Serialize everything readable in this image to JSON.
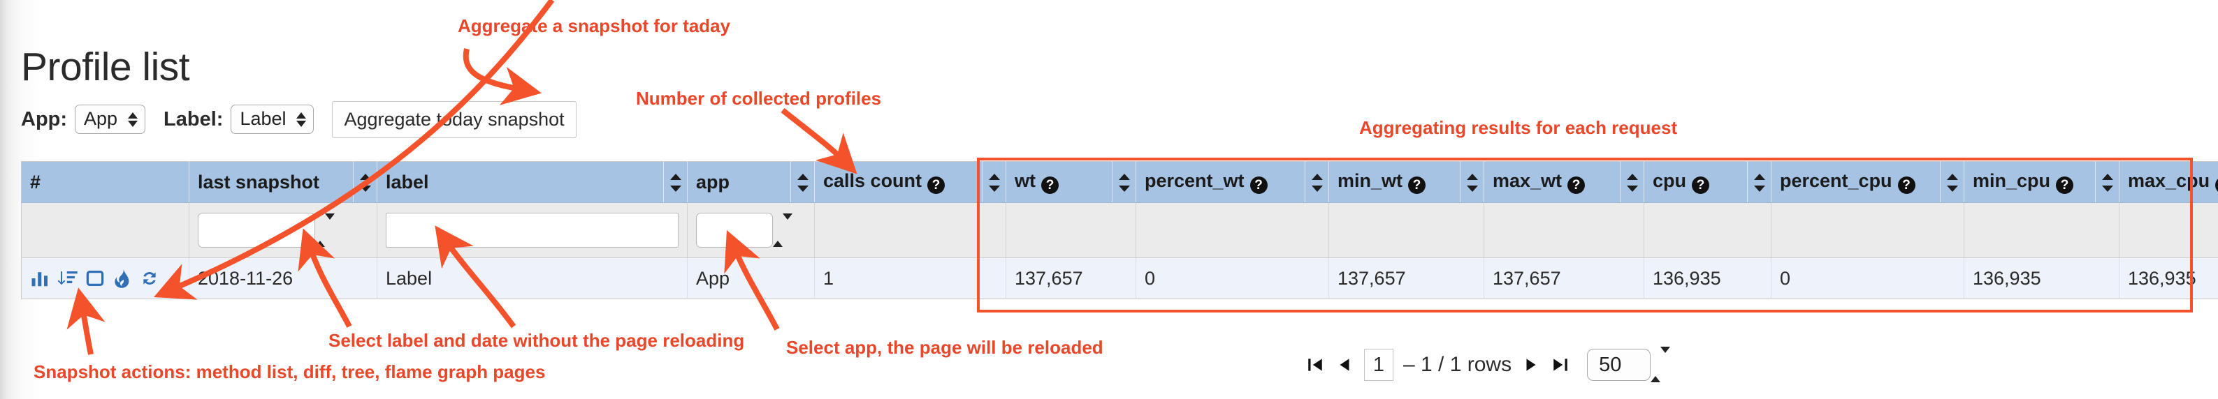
{
  "page": {
    "title": "Profile list"
  },
  "filter_bar": {
    "app_label": "App:",
    "app_select_value": "App",
    "label_label": "Label:",
    "label_select_value": "Label",
    "aggregate_button": "Aggregate today snapshot"
  },
  "table": {
    "columns": [
      {
        "key": "num",
        "label": "#",
        "help": false,
        "sortable": false
      },
      {
        "key": "last_snapshot",
        "label": "last snapshot",
        "help": false,
        "sortable": true
      },
      {
        "key": "label",
        "label": "label",
        "help": false,
        "sortable": true
      },
      {
        "key": "app",
        "label": "app",
        "help": false,
        "sortable": true
      },
      {
        "key": "calls_count",
        "label": "calls count",
        "help": true,
        "sortable": true
      },
      {
        "key": "wt",
        "label": "wt",
        "help": true,
        "sortable": true
      },
      {
        "key": "percent_wt",
        "label": "percent_wt",
        "help": true,
        "sortable": true
      },
      {
        "key": "min_wt",
        "label": "min_wt",
        "help": true,
        "sortable": true
      },
      {
        "key": "max_wt",
        "label": "max_wt",
        "help": true,
        "sortable": true
      },
      {
        "key": "cpu",
        "label": "cpu",
        "help": true,
        "sortable": true
      },
      {
        "key": "percent_cpu",
        "label": "percent_cpu",
        "help": true,
        "sortable": true
      },
      {
        "key": "min_cpu",
        "label": "min_cpu",
        "help": true,
        "sortable": true
      },
      {
        "key": "max_cpu",
        "label": "max_cpu",
        "help": true,
        "sortable": true
      }
    ],
    "help_glyph": "?",
    "filter_row": {
      "last_snapshot_value": "",
      "label_value": "",
      "label_placeholder": "",
      "app_value": ""
    },
    "rows": [
      {
        "actions": [
          "bar-chart-icon",
          "sort-list-icon",
          "tree-square-icon",
          "flame-icon",
          "refresh-icon"
        ],
        "last_snapshot": "2018-11-26",
        "label": "Label",
        "app": "App",
        "calls_count": "1",
        "wt": "137,657",
        "percent_wt": "0",
        "min_wt": "137,657",
        "max_wt": "137,657",
        "cpu": "136,935",
        "percent_cpu": "0",
        "min_cpu": "136,935",
        "max_cpu": "136,935"
      }
    ]
  },
  "pagination": {
    "first_icon": "first-page-icon",
    "prev_icon": "previous-page-icon",
    "page_number": "1",
    "rows_text": "– 1 / 1 rows",
    "next_icon": "next-page-icon",
    "last_icon": "last-page-icon",
    "page_size": "50"
  },
  "annotations": {
    "aggregate": "Aggregate a snapshot for taday",
    "collected": "Number of collected profiles",
    "aggregating": "Aggregating results for each request",
    "select_label": "Select label and date without the page reloading",
    "select_app": "Select app, the page will be reloaded",
    "snapshot_actions": "Snapshot actions: method list, diff, tree, flame graph pages"
  },
  "colors": {
    "header_blue": "#a7c3e4",
    "row_blue": "#eef3fb",
    "filter_gray": "#ebebeb",
    "annotation_red": "#e8472a",
    "box_red": "#f4522a",
    "icon_blue": "#2f6fb5"
  }
}
